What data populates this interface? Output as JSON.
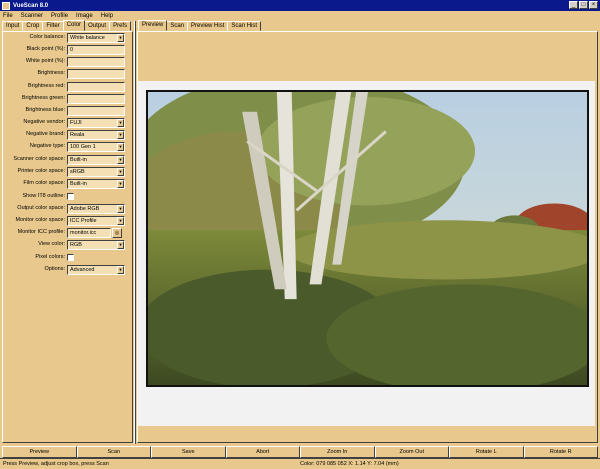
{
  "window": {
    "title": "VueScan 8.0"
  },
  "menu": [
    "File",
    "Scanner",
    "Profile",
    "Image",
    "Help"
  ],
  "left_tabs": [
    {
      "label": "Input",
      "active": false
    },
    {
      "label": "Crop",
      "active": false
    },
    {
      "label": "Filter",
      "active": false
    },
    {
      "label": "Color",
      "active": true
    },
    {
      "label": "Output",
      "active": false
    },
    {
      "label": "Prefs",
      "active": false
    }
  ],
  "right_tabs": [
    {
      "label": "Preview",
      "active": true
    },
    {
      "label": "Scan",
      "active": false
    },
    {
      "label": "Preview Hist",
      "active": false
    },
    {
      "label": "Scan Hist",
      "active": false
    }
  ],
  "color_settings": [
    {
      "label": "Color balance:",
      "type": "select",
      "value": "White balance"
    },
    {
      "label": "Black point (%):",
      "type": "text",
      "value": "0"
    },
    {
      "label": "White point (%):",
      "type": "text",
      "value": ""
    },
    {
      "label": "Brightness:",
      "type": "text",
      "value": ""
    },
    {
      "label": "Brightness red:",
      "type": "text",
      "value": ""
    },
    {
      "label": "Brightness green:",
      "type": "text",
      "value": ""
    },
    {
      "label": "Brightness blue:",
      "type": "text",
      "value": ""
    },
    {
      "label": "Negative vendor:",
      "type": "select",
      "value": "FUJI"
    },
    {
      "label": "Negative brand:",
      "type": "select",
      "value": "Reala"
    },
    {
      "label": "Negative type:",
      "type": "select",
      "value": "100 Gen 1"
    },
    {
      "label": "Scanner color space:",
      "type": "select",
      "value": "Built-in"
    },
    {
      "label": "Printer color space:",
      "type": "select",
      "value": "sRGB"
    },
    {
      "label": "Film color space:",
      "type": "select",
      "value": "Built-in"
    },
    {
      "label": "Show IT8 outline:",
      "type": "checkbox",
      "value": ""
    },
    {
      "label": "Output color space:",
      "type": "select",
      "value": "Adobe RGB"
    },
    {
      "label": "Monitor color space:",
      "type": "select",
      "value": "ICC Profile"
    },
    {
      "label": "Monitor ICC profile:",
      "type": "file",
      "value": "monitor.icc"
    },
    {
      "label": "View color:",
      "type": "select",
      "value": "RGB"
    },
    {
      "label": "Pixel colors:",
      "type": "checkbox",
      "value": ""
    },
    {
      "label": "Options:",
      "type": "select",
      "value": "Advanced"
    }
  ],
  "buttons": [
    "Preview",
    "Scan",
    "Save",
    "Abort",
    "Zoom In",
    "Zoom Out",
    "Rotate L",
    "Rotate R"
  ],
  "status": {
    "message": "Press Preview, adjust crop box, press Scan",
    "coords": "Color: 079 085 052  X:  1.14  Y:  7.04 (mm)"
  },
  "colors": {
    "background": "#e8c88c",
    "titlebar": "#0a1a8c"
  }
}
